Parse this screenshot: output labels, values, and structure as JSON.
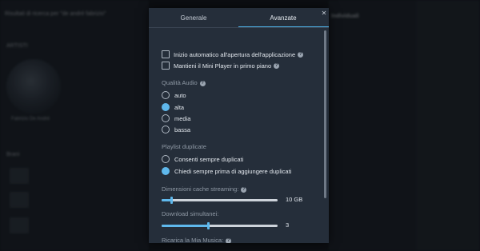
{
  "background": {
    "search_text": "Risultati di ricerca per \"de andré fabrizio\"",
    "right_label": "Individuali",
    "section_artist": "ARTISTI",
    "artist_name": "Fabrizio De André",
    "section_songs": "Brani"
  },
  "tabs": [
    {
      "label": "Generale",
      "active": false
    },
    {
      "label": "Avanzate",
      "active": true
    }
  ],
  "close_icon": "close-icon",
  "checkboxes": [
    {
      "label": "Inizio automatico all'apertura dell'applicazione",
      "checked": false
    },
    {
      "label": "Mantieni il Mini Player in primo piano",
      "checked": false
    }
  ],
  "audio": {
    "title": "Qualità Audio",
    "options": [
      {
        "label": "auto",
        "selected": false
      },
      {
        "label": "alta",
        "selected": true
      },
      {
        "label": "media",
        "selected": false
      },
      {
        "label": "bassa",
        "selected": false
      }
    ]
  },
  "duplicates": {
    "title": "Playlist duplicate",
    "options": [
      {
        "label": "Consenti sempre duplicati",
        "selected": false
      },
      {
        "label": "Chiedi sempre prima di aggiungere duplicati",
        "selected": true
      }
    ]
  },
  "cache": {
    "title": "Dimensioni cache streaming:",
    "value": "10 GB",
    "fraction": 0.08
  },
  "downloads": {
    "title": "Download simultanei:",
    "value": "3",
    "fraction": 0.4
  },
  "reload": {
    "title": "Ricarica la Mia Musica:"
  },
  "colors": {
    "accent": "#5fb8ec",
    "panel": "#252e3a"
  }
}
